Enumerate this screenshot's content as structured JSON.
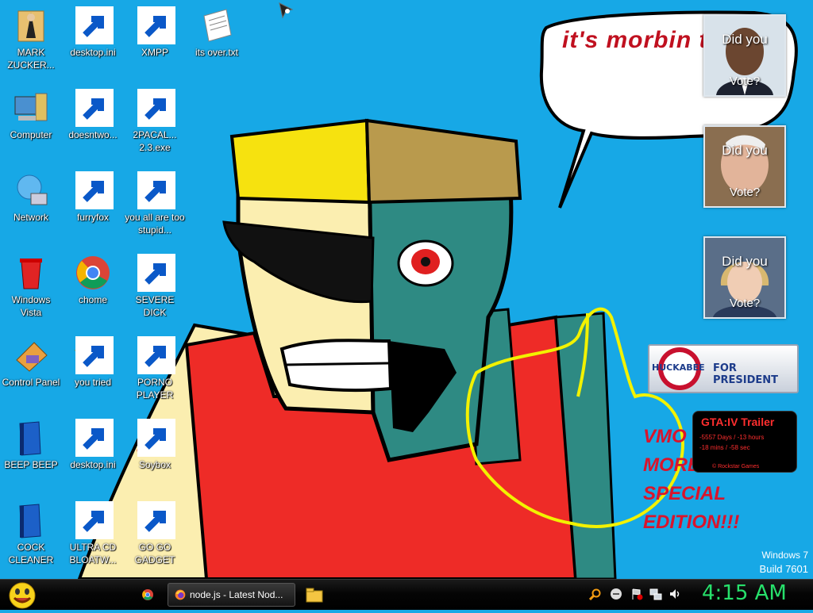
{
  "desktop": {
    "icons": [
      {
        "label": "MARK ZUCKER...",
        "icon": "user-folder-icon"
      },
      {
        "label": "desktop.ini",
        "icon": "ini-file-icon"
      },
      {
        "label": "XMPP",
        "icon": "xampp-icon"
      },
      {
        "label": "its over.txt",
        "icon": "text-file-icon"
      },
      {
        "label": "Computer",
        "icon": "computer-icon"
      },
      {
        "label": "doesntwo...",
        "icon": "yahoo-messenger-icon"
      },
      {
        "label": "2PACAL... 2.3.exe",
        "icon": "console-exe-icon"
      },
      {
        "label": "Network",
        "icon": "network-icon"
      },
      {
        "label": "furryfox",
        "icon": "firefox-icon"
      },
      {
        "label": "you all are too stupid...",
        "icon": "dev-cpp-icon"
      },
      {
        "label": "Windows Vista",
        "icon": "recycle-bin-icon"
      },
      {
        "label": "chome",
        "icon": "chrome-icon"
      },
      {
        "label": "SEVERE DICK",
        "icon": "sd-gear-icon"
      },
      {
        "label": "Control Panel",
        "icon": "control-panel-icon"
      },
      {
        "label": "you tried",
        "icon": "star-icon"
      },
      {
        "label": "PORNO PLAYER",
        "icon": "flash-player-icon"
      },
      {
        "label": "BEEP BEEP",
        "icon": "blue-book-icon"
      },
      {
        "label": "desktop.ini",
        "icon": "ini-file-icon"
      },
      {
        "label": "Soybox",
        "icon": "soybox-icon"
      },
      {
        "label": "COCK CLEANER",
        "icon": "blue-book-icon"
      },
      {
        "label": "ULTRA CD BLOATW...",
        "icon": "cd-disc-icon"
      },
      {
        "label": "GO GO GADGET",
        "icon": "briefcase-icon"
      }
    ]
  },
  "wallpaper": {
    "speech_text": "it's morbin t",
    "special_text": [
      "VMO",
      "MORB",
      "SPECIAL",
      "EDITION!!!"
    ]
  },
  "gadgets": {
    "vote": [
      {
        "line1": "Did you",
        "line2": "Vote?"
      },
      {
        "line1": "Did you",
        "line2": "Vote?"
      },
      {
        "line1": "Did you",
        "line2": "Vote?"
      }
    ],
    "huckabee": {
      "name": "HUCKABEE",
      "tagline": "FOR PRESIDENT"
    },
    "gta": {
      "title": "GTA:IV Trailer",
      "line1": "-5557 Days / -13 hours",
      "line2": "-18 mins / -58 sec",
      "footer": "© Rockstar Games"
    }
  },
  "watermark": {
    "line1": "Windows 7",
    "line2": "Build 7601"
  },
  "taskbar": {
    "start_icon": "smiley-start-icon",
    "window_title": "node.js - Latest Nod...",
    "clock": "4:15 AM"
  },
  "colors": {
    "desktop": "#17a8e6",
    "taskbar": "#000000",
    "clock": "#27e06b"
  }
}
